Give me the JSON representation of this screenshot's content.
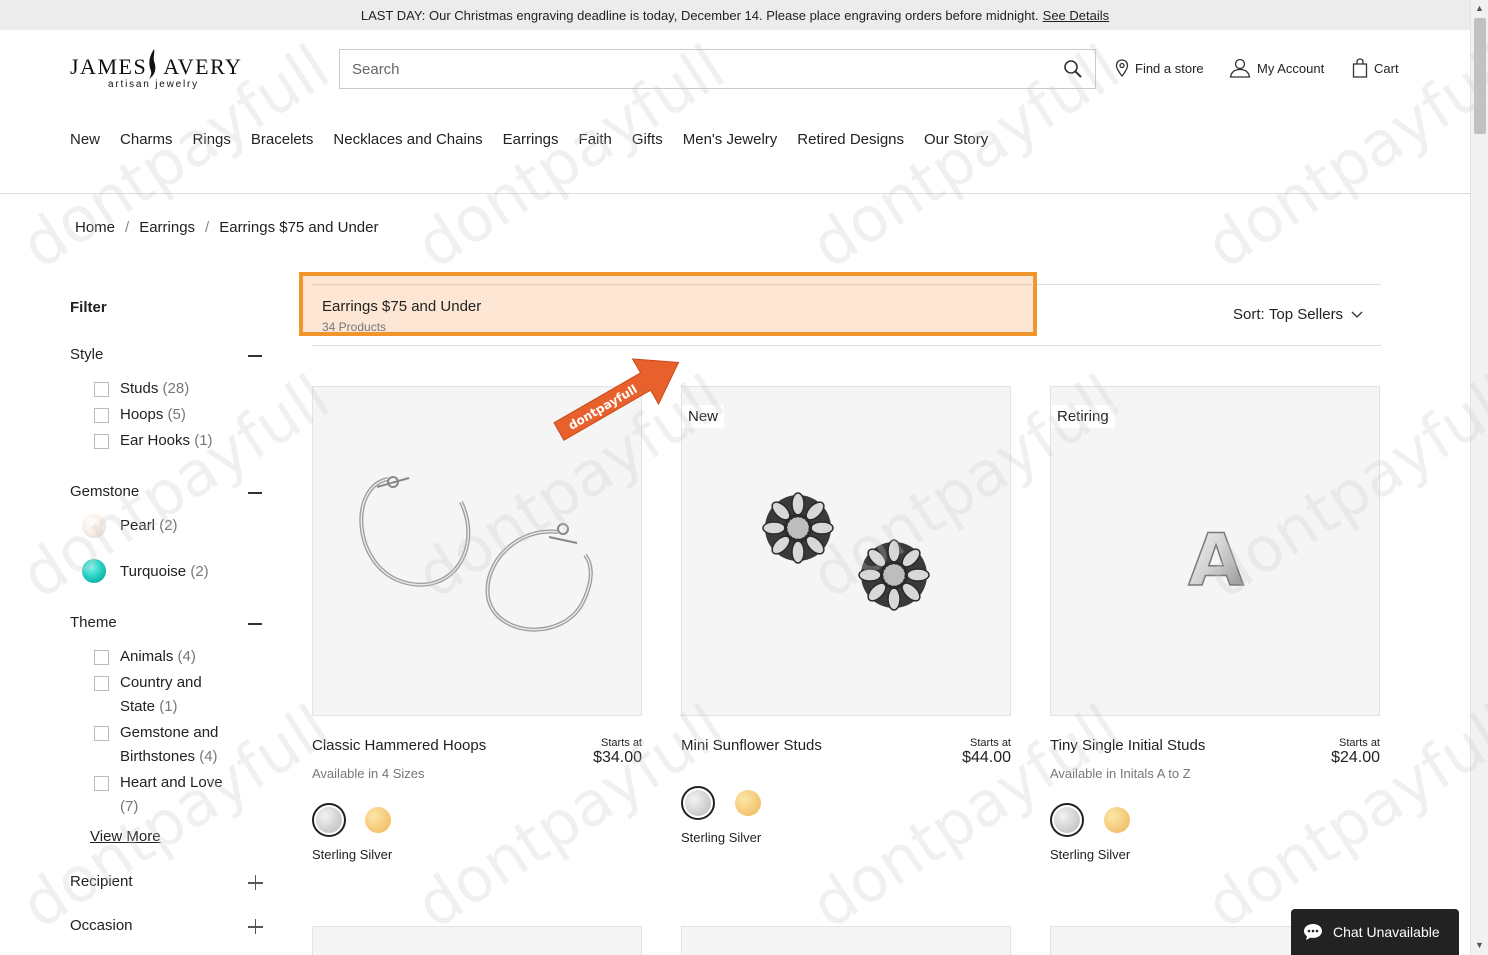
{
  "promo": {
    "text": "LAST DAY: Our Christmas engraving deadline is today, December 14. Please place engraving orders before midnight.",
    "link": "See Details"
  },
  "brand": {
    "name_left": "JAMES",
    "name_right": "AVERY",
    "tagline": "artisan jewelry"
  },
  "search": {
    "placeholder": "Search"
  },
  "utility": {
    "find_store": "Find a store",
    "account": "My Account",
    "cart": "Cart"
  },
  "nav": [
    "New",
    "Charms",
    "Rings",
    "Bracelets",
    "Necklaces and Chains",
    "Earrings",
    "Faith",
    "Gifts",
    "Men's Jewelry",
    "Retired Designs",
    "Our Story"
  ],
  "breadcrumb": [
    "Home",
    "Earrings",
    "Earrings $75 and Under"
  ],
  "filter": {
    "title": "Filter",
    "style": {
      "label": "Style",
      "options": [
        {
          "name": "Studs",
          "count": "(28)"
        },
        {
          "name": "Hoops",
          "count": "(5)"
        },
        {
          "name": "Ear Hooks",
          "count": "(1)"
        }
      ]
    },
    "gemstone": {
      "label": "Gemstone",
      "options": [
        {
          "name": "Pearl",
          "count": "(2)"
        },
        {
          "name": "Turquoise",
          "count": "(2)"
        }
      ]
    },
    "theme": {
      "label": "Theme",
      "options": [
        {
          "name": "Animals",
          "count": "(4)"
        },
        {
          "line1": "Country and",
          "line2": "State",
          "count": "(1)"
        },
        {
          "line1": "Gemstone and",
          "line2": "Birthstones",
          "count": "(4)"
        },
        {
          "line1": "Heart and Love",
          "count": "(7)"
        }
      ]
    },
    "view_more": "View More",
    "recipient": "Recipient",
    "occasion": "Occasion"
  },
  "listing": {
    "title": "Earrings $75 and Under",
    "count": "34 Products",
    "sort_label": "Sort:",
    "sort_value": "Top Sellers"
  },
  "products": [
    {
      "name": "Classic Hammered Hoops",
      "starts": "Starts at",
      "price": "$34.00",
      "availability": "Available in 4 Sizes",
      "metal": "Sterling Silver",
      "badge": ""
    },
    {
      "name": "Mini Sunflower Studs",
      "starts": "Starts at",
      "price": "$44.00",
      "availability": "",
      "metal": "Sterling Silver",
      "badge": "New"
    },
    {
      "name": "Tiny Single Initial Studs",
      "starts": "Starts at",
      "price": "$24.00",
      "availability": "Available in Initals A to Z",
      "metal": "Sterling Silver",
      "badge": "Retiring",
      "initial": "A"
    }
  ],
  "chat": {
    "label": "Chat Unavailable"
  },
  "watermark": {
    "text": "dontpayfull"
  },
  "colors": {
    "highlight_border": "#f0962c",
    "highlight_fill": "#fde6d4",
    "arrow": "#e8612c",
    "silver": "#c9c9c9",
    "gold": "#f2c46a"
  }
}
